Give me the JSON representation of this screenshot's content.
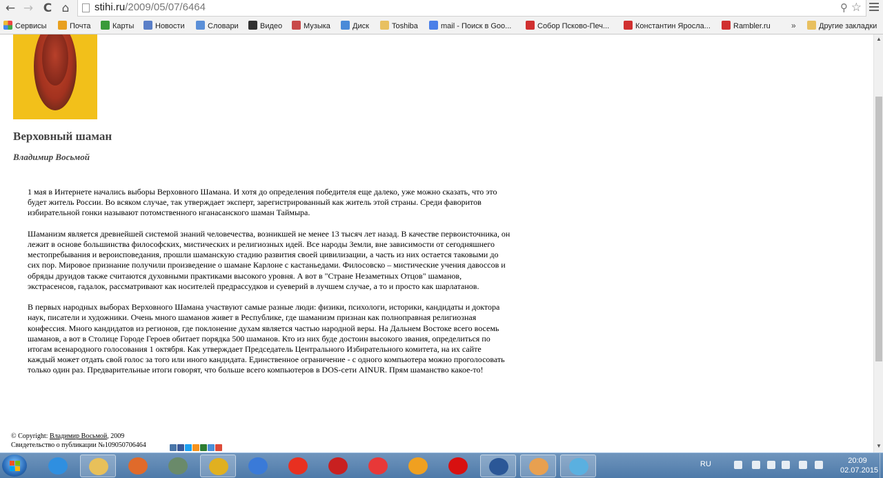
{
  "browser": {
    "url_host": "stihi.ru",
    "url_path": "/2009/05/07/6464",
    "bookmarks": [
      {
        "label": "Сервисы",
        "color": "#e44"
      },
      {
        "label": "Почта",
        "color": "#e8a020"
      },
      {
        "label": "Карты",
        "color": "#3a9a3a"
      },
      {
        "label": "Новости",
        "color": "#5a7fc8"
      },
      {
        "label": "Словари",
        "color": "#5a8fd8"
      },
      {
        "label": "Видео",
        "color": "#333333"
      },
      {
        "label": "Музыка",
        "color": "#c84a4a"
      },
      {
        "label": "Диск",
        "color": "#4a8ad8"
      },
      {
        "label": "Toshiba",
        "color": "#e8c060"
      },
      {
        "label": "mail - Поиск в Goo...",
        "color": "#4a7fe8"
      },
      {
        "label": "Собор Псково-Печ...",
        "color": "#d03030"
      },
      {
        "label": "Константин Яросла...",
        "color": "#d03030"
      },
      {
        "label": "Rambler.ru",
        "color": "#d03030"
      },
      {
        "label": "Другие закладки",
        "color": "#e8c060"
      }
    ],
    "more_bookmarks": "»"
  },
  "page": {
    "title": "Верховный шаман",
    "author": "Владимир Восьмой",
    "paragraphs": [
      "1 мая в Интернете начались выборы Верховного Шамана. И хотя до определения победителя еще далеко, уже можно сказать, что это будет житель России. Во всяком случае, так утверждает эксперт, зарегистрированный как житель этой страны. Среди фаворитов избирательной гонки называют потомственного нганасанского шаман Таймыра.",
      "Шаманизм является древнейшей системой знаний человечества, возникшей не менее 13 тысяч лет назад. В качестве первоисточника, он лежит в основе большинства философских, мистических и религиозных идей. Все народы Земли, вне зависимости от сегодняшнего местопребывания и вероисповедания, прошли шаманскую стадию развития своей цивилизации, а часть из них остается таковыми до сих пор. Мировое признание получили произведение о шамане Карлоне с кастаньедами. Филосовско – мистические учения давоссов и обряды друидов также считаются духовными практиками высокого уровня. А вот в \"Стране Незаметных Отцов\" шаманов, экстрасенсов, гадалок, рассматривают как носителей предрассудков и суеверий в лучшем случае, а то и просто как шарлатанов.",
      "В первых народных выборах Верховного Шамана участвуют самые разные люди: физики, психологи, историки, кандидаты и доктора наук, писатели и художники. Очень много шаманов живет в Республике, где шаманизм признан как полноправная религиозная конфессия. Много кандидатов из регионов, где поклонение духам является частью народной веры. На Дальнем Востоке всего восемь шаманов, а вот в Столице Городе Героев обитает порядка 500 шаманов. Кто из них буде достоин высокого звания, определиться по итогам всенародного голосования 1 октября. Как утверждает Председатель Центрального Избирательного комитета, на их сайте каждый может отдать свой голос за того или иного кандидата. Единственное ограничение - с одного компьютера можно проголосовать только один раз.  Предварительные итоги говорят, что больше всего компьютеров в DOS-сети AINUR. Прям шаманство какое-то!"
    ],
    "copyright_prefix": "© Copyright: ",
    "copyright_author": "Владимир Восьмой",
    "copyright_year": ", 2009",
    "certificate": "Свидетельство о публикации №109050706464"
  },
  "share_colors": [
    "#4a76a8",
    "#3b5998",
    "#1da1f2",
    "#f7931e",
    "#2e7d32",
    "#4a90d9",
    "#dd4b39"
  ],
  "taskbar": {
    "apps": [
      {
        "name": "internet-explorer",
        "color": "#2f8fe0",
        "open": false
      },
      {
        "name": "file-explorer",
        "color": "#e8c05a",
        "open": true
      },
      {
        "name": "media-player",
        "color": "#e06a2a",
        "open": false
      },
      {
        "name": "media-center",
        "color": "#6a8a6a",
        "open": false
      },
      {
        "name": "chrome",
        "color": "#e0b020",
        "open": true
      },
      {
        "name": "mail",
        "color": "#3a7ad8",
        "open": false
      },
      {
        "name": "yandex-browser",
        "color": "#e83020",
        "open": false
      },
      {
        "name": "kaspersky",
        "color": "#c82020",
        "open": false
      },
      {
        "name": "yandex",
        "color": "#e83838",
        "open": false
      },
      {
        "name": "weather",
        "color": "#f0a020",
        "open": false
      },
      {
        "name": "opera",
        "color": "#d81010",
        "open": false
      },
      {
        "name": "word",
        "color": "#2b5797",
        "open": true
      },
      {
        "name": "eye-app",
        "color": "#e8a050",
        "open": true
      },
      {
        "name": "paint",
        "color": "#5ab0e0",
        "open": true
      }
    ],
    "language": "RU",
    "time": "20:09",
    "date": "02.07.2015"
  }
}
